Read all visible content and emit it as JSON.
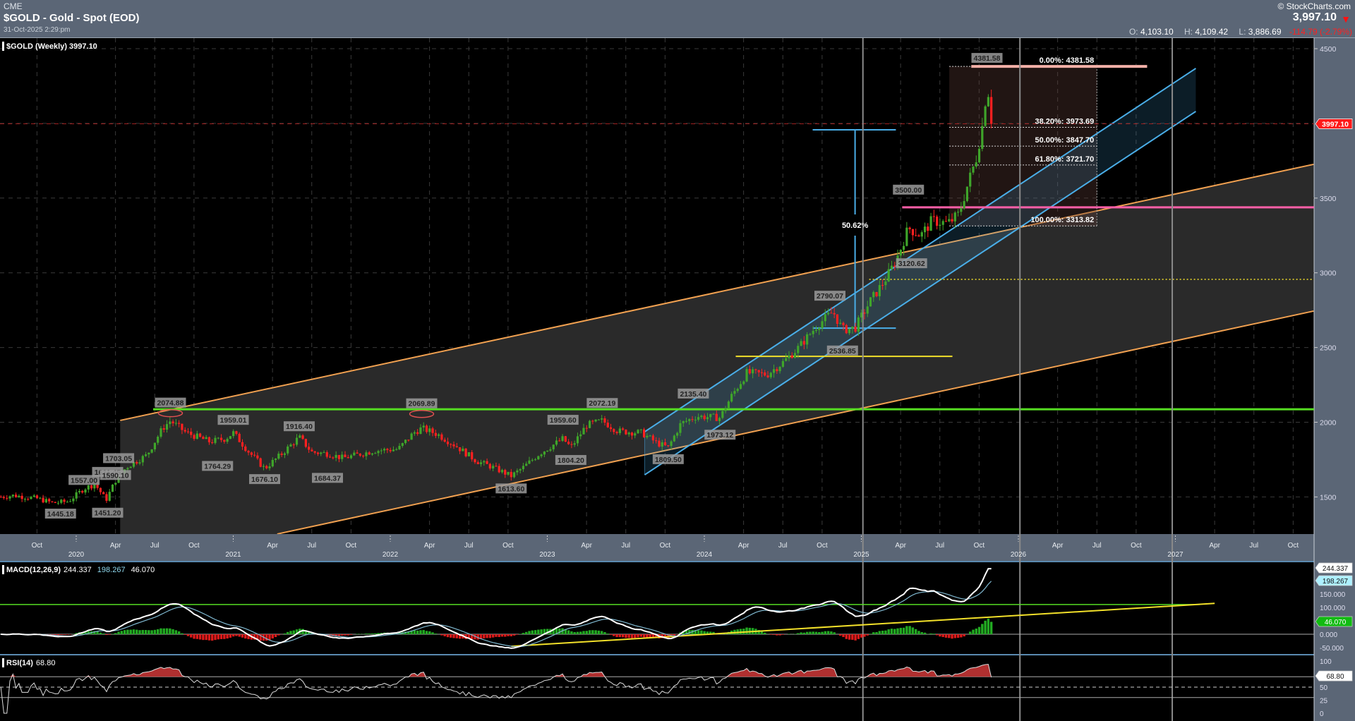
{
  "header": {
    "exchange": "CME",
    "title": "$GOLD - Gold - Spot (EOD)",
    "datetime": "31-Oct-2025 2:29:pm",
    "brand": "© StockCharts.com",
    "last": "3,997.10",
    "direction_icon": "down-triangle-icon",
    "open_label": "O:",
    "open": "4,103.10",
    "high_label": "H:",
    "high": "4,109.42",
    "low_label": "L:",
    "low": "3,886.69",
    "change": "-114.79 (-2.79%)"
  },
  "colors": {
    "header_bg": "#5b6676",
    "up": "#3fa52a",
    "down": "#ff2020",
    "orange": "#f0a050",
    "green": "#55dd22",
    "blue": "#4aaee8",
    "yellow": "#f2e02a",
    "pink": "#ff5fa8",
    "fib": "#f4b0a8"
  },
  "chart_data": [
    {
      "type": "candlestick",
      "title": "$GOLD (Weekly) 3997.10",
      "period": "Weekly",
      "ylim": [
        1252,
        4620
      ],
      "xlim": [
        2019.5,
        2027.88
      ],
      "y_ticks": [
        1500,
        2000,
        2500,
        3000,
        3500,
        4500
      ],
      "current_price": 3997.1,
      "current_price_label": "3997.10",
      "x_ticks": [
        {
          "t": 2019.75,
          "label": "Oct"
        },
        {
          "t": 2020.25,
          "label": "Apr"
        },
        {
          "t": 2020.5,
          "label": "Jul"
        },
        {
          "t": 2020.75,
          "label": "Oct"
        },
        {
          "t": 2021.25,
          "label": "Apr"
        },
        {
          "t": 2021.5,
          "label": "Jul"
        },
        {
          "t": 2021.75,
          "label": "Oct"
        },
        {
          "t": 2022.25,
          "label": "Apr"
        },
        {
          "t": 2022.5,
          "label": "Jul"
        },
        {
          "t": 2022.75,
          "label": "Oct"
        },
        {
          "t": 2023.25,
          "label": "Apr"
        },
        {
          "t": 2023.5,
          "label": "Jul"
        },
        {
          "t": 2023.75,
          "label": "Oct"
        },
        {
          "t": 2024.25,
          "label": "Apr"
        },
        {
          "t": 2024.5,
          "label": "Jul"
        },
        {
          "t": 2024.75,
          "label": "Oct"
        },
        {
          "t": 2025.25,
          "label": "Apr"
        },
        {
          "t": 2025.5,
          "label": "Jul"
        },
        {
          "t": 2025.75,
          "label": "Oct"
        },
        {
          "t": 2026.25,
          "label": "Apr"
        },
        {
          "t": 2026.5,
          "label": "Jul"
        },
        {
          "t": 2026.75,
          "label": "Oct"
        },
        {
          "t": 2027.25,
          "label": "Apr"
        },
        {
          "t": 2027.5,
          "label": "Jul"
        },
        {
          "t": 2027.75,
          "label": "Oct"
        }
      ],
      "year_labels": [
        {
          "t": 2020,
          "label": "2020"
        },
        {
          "t": 2021,
          "label": "2021"
        },
        {
          "t": 2022,
          "label": "2022"
        },
        {
          "t": 2023,
          "label": "2023"
        },
        {
          "t": 2024,
          "label": "2024"
        },
        {
          "t": 2025,
          "label": "2025"
        },
        {
          "t": 2026,
          "label": "2026"
        },
        {
          "t": 2027,
          "label": "2027"
        }
      ],
      "close_anchors": [
        [
          2019.52,
          1500
        ],
        [
          2019.6,
          1510
        ],
        [
          2019.75,
          1490
        ],
        [
          2019.85,
          1460
        ],
        [
          2019.95,
          1470
        ],
        [
          2020.05,
          1557
        ],
        [
          2020.12,
          1585
        ],
        [
          2020.19,
          1480
        ],
        [
          2020.25,
          1610
        ],
        [
          2020.32,
          1700
        ],
        [
          2020.45,
          1780
        ],
        [
          2020.55,
          1960
        ],
        [
          2020.6,
          2010
        ],
        [
          2020.7,
          1930
        ],
        [
          2020.85,
          1870
        ],
        [
          2020.95,
          1890
        ],
        [
          2021.0,
          1930
        ],
        [
          2021.1,
          1800
        ],
        [
          2021.2,
          1690
        ],
        [
          2021.3,
          1780
        ],
        [
          2021.42,
          1900
        ],
        [
          2021.5,
          1800
        ],
        [
          2021.6,
          1790
        ],
        [
          2021.7,
          1760
        ],
        [
          2021.9,
          1810
        ],
        [
          2022.05,
          1820
        ],
        [
          2022.15,
          1930
        ],
        [
          2022.2,
          1960
        ],
        [
          2022.3,
          1920
        ],
        [
          2022.42,
          1840
        ],
        [
          2022.55,
          1740
        ],
        [
          2022.65,
          1700
        ],
        [
          2022.77,
          1640
        ],
        [
          2022.85,
          1700
        ],
        [
          2022.95,
          1790
        ],
        [
          2023.1,
          1890
        ],
        [
          2023.15,
          1830
        ],
        [
          2023.25,
          1980
        ],
        [
          2023.35,
          2010
        ],
        [
          2023.45,
          1940
        ],
        [
          2023.6,
          1930
        ],
        [
          2023.7,
          1860
        ],
        [
          2023.77,
          1830
        ],
        [
          2023.85,
          1990
        ],
        [
          2023.95,
          2040
        ],
        [
          2024.1,
          2030
        ],
        [
          2024.17,
          2170
        ],
        [
          2024.27,
          2330
        ],
        [
          2024.4,
          2320
        ],
        [
          2024.5,
          2400
        ],
        [
          2024.6,
          2500
        ],
        [
          2024.72,
          2650
        ],
        [
          2024.82,
          2740
        ],
        [
          2024.88,
          2620
        ],
        [
          2024.96,
          2630
        ],
        [
          2025.05,
          2800
        ],
        [
          2025.15,
          2950
        ],
        [
          2025.22,
          3080
        ],
        [
          2025.3,
          3300
        ],
        [
          2025.38,
          3250
        ],
        [
          2025.45,
          3350
        ],
        [
          2025.55,
          3330
        ],
        [
          2025.62,
          3390
        ],
        [
          2025.68,
          3600
        ],
        [
          2025.73,
          3760
        ],
        [
          2025.77,
          3980
        ],
        [
          2025.8,
          4250
        ],
        [
          2025.81,
          4200
        ],
        [
          2025.83,
          3997
        ]
      ],
      "price_labels": [
        {
          "text": "1557.00",
          "t": 2020.05,
          "p": 1557,
          "pos": "above"
        },
        {
          "text": "1445.18",
          "t": 2019.9,
          "p": 1445.18,
          "pos": "below"
        },
        {
          "text": "1611.45",
          "t": 2020.2,
          "p": 1611,
          "pos": "above"
        },
        {
          "text": "1590.10",
          "t": 2020.25,
          "p": 1590.1,
          "pos": "above"
        },
        {
          "text": "1451.20",
          "t": 2020.2,
          "p": 1451.2,
          "pos": "below"
        },
        {
          "text": "1703.05",
          "t": 2020.27,
          "p": 1703.05,
          "pos": "above"
        },
        {
          "text": "2074.88",
          "t": 2020.6,
          "p": 2074.88,
          "pos": "above"
        },
        {
          "text": "1959.01",
          "t": 2021.0,
          "p": 1959.01,
          "pos": "above"
        },
        {
          "text": "1764.29",
          "t": 2020.9,
          "p": 1764.29,
          "pos": "below"
        },
        {
          "text": "1676.10",
          "t": 2021.2,
          "p": 1676.1,
          "pos": "below"
        },
        {
          "text": "1916.40",
          "t": 2021.42,
          "p": 1916.4,
          "pos": "above"
        },
        {
          "text": "1684.37",
          "t": 2021.6,
          "p": 1684.37,
          "pos": "below"
        },
        {
          "text": "2069.89",
          "t": 2022.2,
          "p": 2069.89,
          "pos": "above"
        },
        {
          "text": "1613.60",
          "t": 2022.77,
          "p": 1613.6,
          "pos": "below"
        },
        {
          "text": "1959.60",
          "t": 2023.1,
          "p": 1959.6,
          "pos": "above"
        },
        {
          "text": "1804.20",
          "t": 2023.15,
          "p": 1804.2,
          "pos": "below"
        },
        {
          "text": "2072.19",
          "t": 2023.35,
          "p": 2072.19,
          "pos": "above"
        },
        {
          "text": "1809.50",
          "t": 2023.77,
          "p": 1809.5,
          "pos": "below"
        },
        {
          "text": "2135.40",
          "t": 2023.93,
          "p": 2135.4,
          "pos": "above"
        },
        {
          "text": "1973.12",
          "t": 2024.1,
          "p": 1973.12,
          "pos": "below"
        },
        {
          "text": "2790.07",
          "t": 2024.8,
          "p": 2790.07,
          "pos": "above"
        },
        {
          "text": "2536.85",
          "t": 2024.88,
          "p": 2536.85,
          "pos": "below"
        },
        {
          "text": "3500.00",
          "t": 2025.3,
          "p": 3500,
          "pos": "above"
        },
        {
          "text": "3120.62",
          "t": 2025.32,
          "p": 3120.62,
          "pos": "below"
        },
        {
          "text": "4381.58",
          "t": 2025.8,
          "p": 4381.58,
          "pos": "above"
        }
      ],
      "annotations": {
        "orange_channel": {
          "upper": [
            [
              2020.28,
              2012
            ],
            [
              2027.88,
              3726
            ]
          ],
          "lower": [
            [
              2021.28,
              1252
            ],
            [
              2027.88,
              2744
            ]
          ]
        },
        "blue_channel": {
          "upper": [
            [
              2023.62,
              1936
            ],
            [
              2027.13,
              4368
            ]
          ],
          "lower": [
            [
              2023.62,
              1648
            ],
            [
              2027.13,
              4080
            ]
          ]
        },
        "green_resistance": {
          "p": 2087,
          "from": 2020.49
        },
        "yellow_support": {
          "p": 2441,
          "from": 2024.2,
          "to": 2025.58
        },
        "yellow_dotted": {
          "p": 2956,
          "from": 2025.05
        },
        "pink_resistance": {
          "p": 3438,
          "from": 2025.26
        },
        "verticals": [
          2025.01,
          2026.01,
          2026.98
        ],
        "measure": {
          "t": 2024.96,
          "from_t": 2024.69,
          "to_t": 2025.22,
          "low": 2630,
          "high": 3957,
          "label": "50.62%"
        },
        "fibonacci": {
          "from_t": 2025.56,
          "to_t": 2026.5,
          "levels": [
            {
              "p": 4381.58,
              "label": "0.00%: 4381.58"
            },
            {
              "p": 3973.69,
              "label": "38.20%: 3973.69"
            },
            {
              "p": 3847.7,
              "label": "50.00%: 3847.70"
            },
            {
              "p": 3721.7,
              "label": "61.80%: 3721.70"
            },
            {
              "p": 3313.82,
              "label": "100.00%: 3313.82"
            }
          ]
        },
        "ellipses": [
          {
            "t": 2020.6,
            "p": 2074.88
          },
          {
            "t": 2022.2,
            "p": 2069.89
          }
        ]
      }
    },
    {
      "type": "line",
      "title": "MACD(12,26,9)",
      "values_label": [
        "244.337",
        "198.267",
        "46.070"
      ],
      "series": [
        {
          "name": "MACD",
          "last": 244.337
        },
        {
          "name": "Signal",
          "last": 198.267
        },
        {
          "name": "Histogram",
          "last": 46.07
        }
      ],
      "y_ticks": [
        "150.000",
        "100.000",
        "0.000",
        "-50.000"
      ],
      "y_tick_values": [
        150,
        100,
        0,
        -50
      ],
      "green_line": 111,
      "trendline": [
        [
          2022.77,
          -45
        ],
        [
          2027.25,
          115
        ]
      ]
    },
    {
      "type": "line",
      "title": "RSI(14)",
      "value_label": "68.80",
      "last": 68.8,
      "y_ticks": [
        "100",
        "50",
        "25",
        "0"
      ],
      "y_tick_values": [
        100,
        50,
        25,
        0
      ]
    }
  ]
}
